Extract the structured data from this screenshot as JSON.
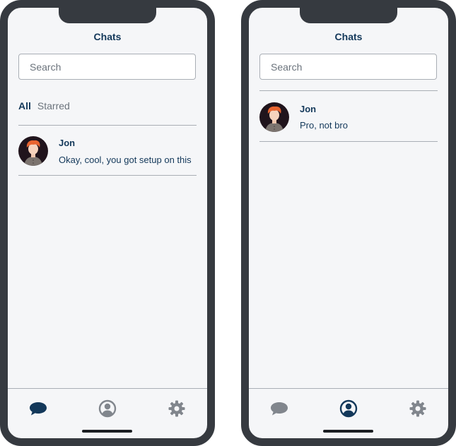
{
  "screens": [
    {
      "title": "Chats",
      "search_placeholder": "Search",
      "tabs": {
        "all": "All",
        "starred": "Starred"
      },
      "chat": {
        "name": "Jon",
        "message": "Okay, cool, you got setup on this"
      },
      "active_tab": "chats"
    },
    {
      "title": "Chats",
      "search_placeholder": "Search",
      "chat": {
        "name": "Jon",
        "message": "Pro, not bro"
      },
      "active_tab": "profile"
    }
  ],
  "tabbar_icons": [
    "chat-bubble-icon",
    "user-icon",
    "gear-icon"
  ],
  "colors": {
    "active": "#13385a",
    "inactive": "#81868d",
    "frame": "#363a40"
  }
}
